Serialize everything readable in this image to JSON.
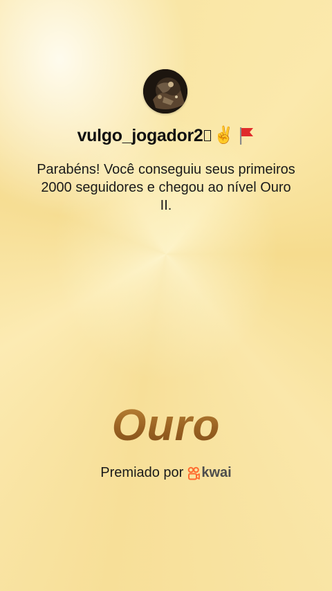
{
  "profile": {
    "username": "vulgo_jogador2",
    "avatar_icon": "profile-photo",
    "emojis": [
      "missing-glyph-box",
      "victory-hand-icon",
      "red-flag-icon"
    ],
    "victory_hand_glyph": "✌️"
  },
  "message": {
    "text": "Parabéns! Você conseguiu seus primeiros 2000 seguidores e chegou ao nível Ouro II."
  },
  "badge": {
    "title": "Ouro",
    "colors": {
      "gold_light": "#c08a3a",
      "gold_dark": "#7e4c18"
    }
  },
  "footer": {
    "awarded_by": "Premiado por",
    "brand": "kwai",
    "brand_color": "#ff6a2e"
  }
}
